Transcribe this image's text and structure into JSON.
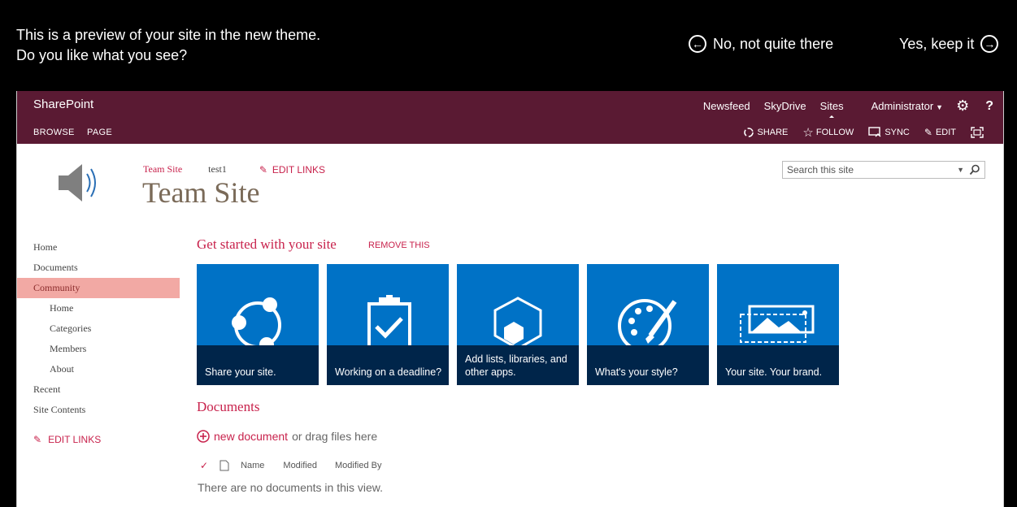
{
  "preview": {
    "message_line1": "This is a preview of your site in the new theme.",
    "message_line2": "Do you like what you see?",
    "no_label": "No, not quite there",
    "yes_label": "Yes, keep it"
  },
  "suitebar": {
    "brand": "SharePoint",
    "links": [
      "Newsfeed",
      "SkyDrive",
      "Sites",
      "Administrator"
    ],
    "help": "?"
  },
  "ribbon": {
    "tabs": [
      "BROWSE",
      "PAGE"
    ],
    "actions": [
      "SHARE",
      "FOLLOW",
      "SYNC",
      "EDIT"
    ]
  },
  "header": {
    "breadcrumb_site": "Team Site",
    "breadcrumb_test": "test1",
    "edit_links": "EDIT LINKS",
    "title": "Team Site",
    "search_placeholder": "Search this site"
  },
  "nav": {
    "items": [
      "Home",
      "Documents",
      "Community",
      "Home",
      "Categories",
      "Members",
      "About",
      "Recent",
      "Site Contents"
    ],
    "edit_links": "EDIT LINKS"
  },
  "get_started": {
    "title": "Get started with your site",
    "remove": "REMOVE THIS",
    "tiles": [
      {
        "caption": "Share your site.",
        "icon": "share-icon"
      },
      {
        "caption": "Working on a deadline?",
        "icon": "clipboard-check-icon"
      },
      {
        "caption": "Add lists, libraries, and other apps.",
        "icon": "apps-hexagon-icon"
      },
      {
        "caption": "What's your style?",
        "icon": "palette-icon"
      },
      {
        "caption": "Your site. Your brand.",
        "icon": "image-brand-icon"
      }
    ]
  },
  "documents": {
    "title": "Documents",
    "new_doc": "new document",
    "drag_text": "or drag files here",
    "columns": [
      "Name",
      "Modified",
      "Modified By"
    ],
    "empty": "There are no documents in this view."
  },
  "colors": {
    "suitebar": "#5a1a33",
    "accent": "#c8224c",
    "tile": "#0072c6",
    "tile_band": "#00254a",
    "nav_selected": "#f2a9a4"
  }
}
